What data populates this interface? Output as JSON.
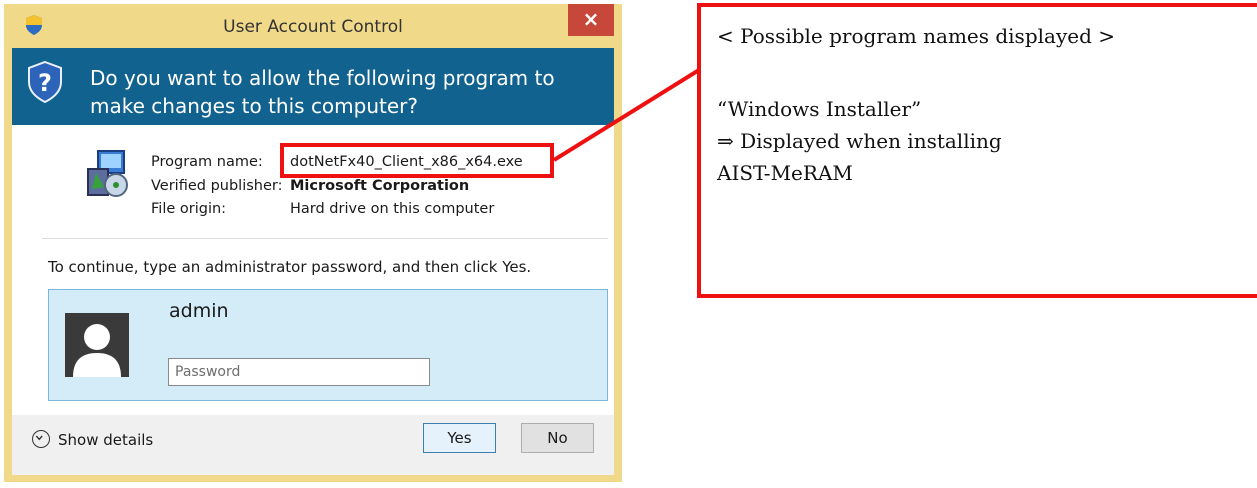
{
  "dialog": {
    "title": "User Account Control",
    "close_glyph": "×",
    "question": "Do you want to allow the following program to make changes to this computer?",
    "program_name_label": "Program name:",
    "program_name_value": "dotNetFx40_Client_x86_x64.exe",
    "publisher_label": "Verified publisher:",
    "publisher_value": "Microsoft Corporation",
    "origin_label": "File origin:",
    "origin_value": "Hard drive on this computer",
    "continue_text": "To continue, type an administrator password, and then click Yes.",
    "username": "admin",
    "password_placeholder": "Password",
    "password_value": "",
    "show_details": "Show details",
    "yes_label": "Yes",
    "no_label": "No",
    "icons": [
      "uac-shield-icon",
      "question-shield-icon",
      "installer-program-icon",
      "user-avatar-icon",
      "chevron-down-icon"
    ]
  },
  "annotation": {
    "heading": "< Possible program names displayed >",
    "program": "“Windows Installer”",
    "note_line1": "⇒ Displayed when installing",
    "note_line2": "AIST-MeRAM",
    "color": "#ee1111"
  },
  "colors": {
    "title_bar": "#f1d98a",
    "header_bg": "#12628f",
    "credential_box": "#d4ecf8",
    "close_button": "#c7473a"
  }
}
